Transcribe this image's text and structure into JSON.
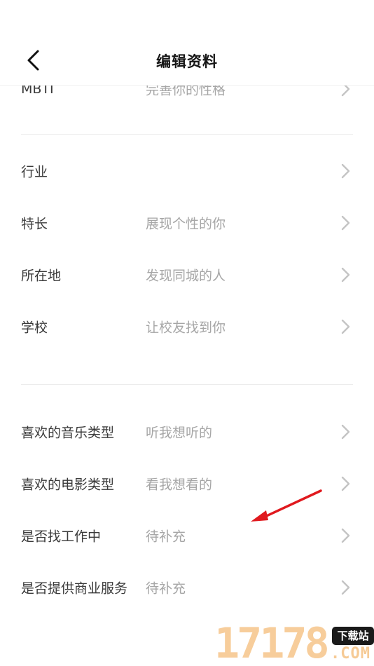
{
  "header": {
    "title": "编辑资料",
    "back_icon": "chevron-left-icon"
  },
  "section1": {
    "rows": [
      {
        "label": "MBTI",
        "value": "完善你的性格"
      }
    ]
  },
  "section2": {
    "rows": [
      {
        "label": "行业",
        "value": ""
      },
      {
        "label": "特长",
        "value": "展现个性的你"
      },
      {
        "label": "所在地",
        "value": "发现同城的人"
      },
      {
        "label": "学校",
        "value": "让校友找到你"
      }
    ]
  },
  "section3": {
    "rows": [
      {
        "label": "喜欢的音乐类型",
        "value": "听我想听的"
      },
      {
        "label": "喜欢的电影类型",
        "value": "看我想看的"
      },
      {
        "label": "是否找工作中",
        "value": "待补充"
      },
      {
        "label": "是否提供商业服务",
        "value": "待补充"
      }
    ]
  },
  "colors": {
    "label": "#3a3a3a",
    "value": "#a6a6a6",
    "chevron": "#c4c4c4",
    "divider": "#ececec",
    "annotation": "#e0191e"
  },
  "watermark": {
    "digits": "17178",
    "badge": "下载站",
    "suffix": ".COM"
  }
}
